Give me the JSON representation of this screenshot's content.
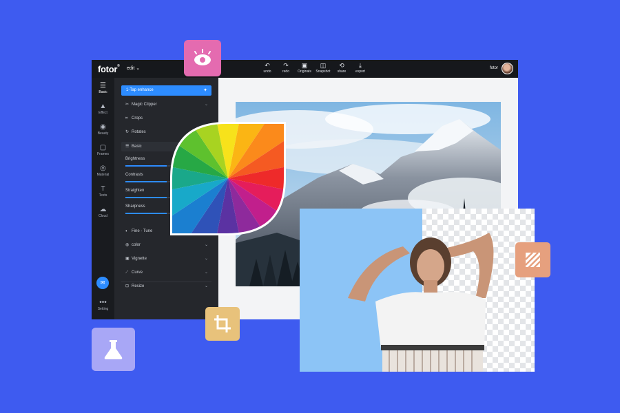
{
  "header": {
    "logo": "fotor",
    "logo_mark": "®",
    "edit_menu": "edit ⌄",
    "user_name": "fotor"
  },
  "toolbar": [
    {
      "icon": "undo-icon",
      "glyph": "↶",
      "label": "undo"
    },
    {
      "icon": "redo-icon",
      "glyph": "↷",
      "label": "redo"
    },
    {
      "icon": "originals-icon",
      "glyph": "▣",
      "label": "Originals"
    },
    {
      "icon": "snapshot-icon",
      "glyph": "◫",
      "label": "Snapshot"
    },
    {
      "icon": "share-icon",
      "glyph": "⟲",
      "label": "share"
    },
    {
      "icon": "export-icon",
      "glyph": "⤓",
      "label": "export"
    }
  ],
  "sidebar": {
    "items": [
      {
        "icon": "sliders-icon",
        "glyph": "☰",
        "label": "Basic"
      },
      {
        "icon": "flask-icon",
        "glyph": "▲",
        "label": "Effect"
      },
      {
        "icon": "beauty-eye-icon",
        "glyph": "◉",
        "label": "Beauty"
      },
      {
        "icon": "frame-icon",
        "glyph": "▢",
        "label": "Frames"
      },
      {
        "icon": "material-icon",
        "glyph": "◎",
        "label": "Material"
      },
      {
        "icon": "text-icon",
        "glyph": "T",
        "label": "Texts"
      },
      {
        "icon": "cloud-icon",
        "glyph": "☁",
        "label": "Cloud"
      }
    ],
    "setting_label": "Setting",
    "setting_glyph": "•••"
  },
  "panel": {
    "enhance_label": "1-Tap enhance",
    "rows": [
      {
        "icon": "magic-clipper-icon",
        "glyph": "✂",
        "label": "Magic Clipper",
        "chevron": true
      },
      {
        "icon": "crop-icon",
        "glyph": "⌗",
        "label": "Crops",
        "chevron": false
      },
      {
        "icon": "rotate-icon",
        "glyph": "↻",
        "label": "Rotates",
        "chevron": false
      }
    ],
    "basic_label": "Basic",
    "sliders": [
      {
        "label": "Brightness",
        "value": 0.5
      },
      {
        "label": "Contrasts",
        "value": 0.5
      },
      {
        "label": "Straighten",
        "value": 0.5
      },
      {
        "label": "Sharpness",
        "value": 0.5
      }
    ],
    "more_rows": [
      {
        "icon": "fine-tune-icon",
        "glyph": "◐",
        "label": "Fine - Tune",
        "chevron": true
      },
      {
        "icon": "color-icon",
        "glyph": "◍",
        "label": "color",
        "chevron": true
      },
      {
        "icon": "vignette-icon",
        "glyph": "▣",
        "label": "Vignette",
        "chevron": true
      },
      {
        "icon": "curve-icon",
        "glyph": "⟋",
        "label": "Curve",
        "chevron": true
      },
      {
        "icon": "resize-icon",
        "glyph": "⊡",
        "label": "Resize",
        "chevron": true
      }
    ]
  },
  "colors": {
    "background": "#3e5bf0",
    "accent": "#2d8cff",
    "eye_tile": "#e46bb0",
    "crop_tile": "#e8c27b",
    "flask_tile": "#a8a7f6",
    "hatch_tile": "#e6a07e"
  }
}
